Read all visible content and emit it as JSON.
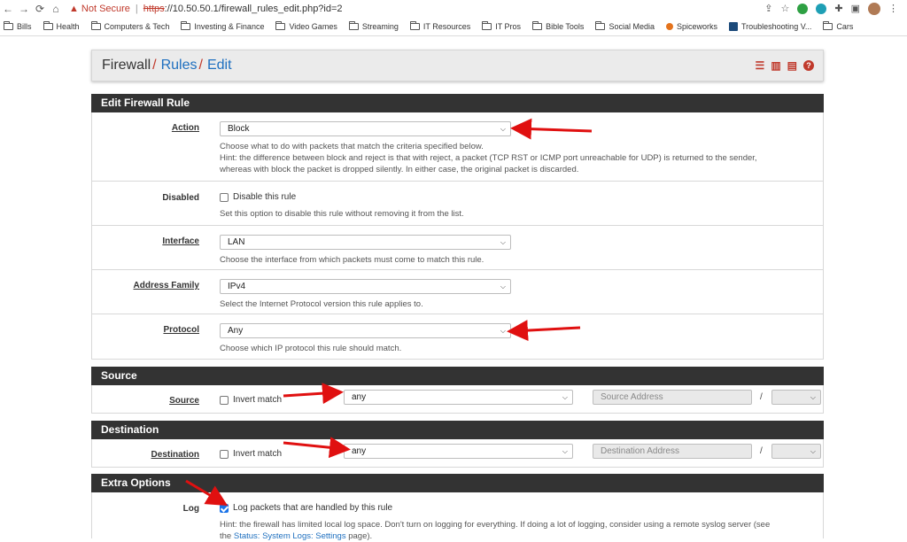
{
  "browser": {
    "security_label": "Not Secure",
    "url_protocol": "https",
    "url_rest": "://10.50.50.1/firewall_rules_edit.php?id=2",
    "bookmarks": [
      "Bills",
      "Health",
      "Computers & Tech",
      "Investing & Finance",
      "Video Games",
      "Streaming",
      "IT Resources",
      "IT Pros",
      "Bible Tools",
      "Social Media",
      "Spiceworks",
      "Troubleshooting V...",
      "Cars"
    ]
  },
  "breadcrumb": {
    "part1": "Firewall",
    "part2": "Rules",
    "part3": "Edit",
    "sep": "/"
  },
  "sections": {
    "edit_rule": "Edit Firewall Rule",
    "source": "Source",
    "destination": "Destination",
    "extra": "Extra Options"
  },
  "fields": {
    "action": {
      "label": "Action",
      "value": "Block",
      "help1": "Choose what to do with packets that match the criteria specified below.",
      "help2": "Hint: the difference between block and reject is that with reject, a packet (TCP RST or ICMP port unreachable for UDP) is returned to the sender,",
      "help3": "whereas with block the packet is dropped silently. In either case, the original packet is discarded."
    },
    "disabled": {
      "label": "Disabled",
      "checkbox": "Disable this rule",
      "help": "Set this option to disable this rule without removing it from the list."
    },
    "interface": {
      "label": "Interface",
      "value": "LAN",
      "help": "Choose the interface from which packets must come to match this rule."
    },
    "address_family": {
      "label": "Address Family",
      "value": "IPv4",
      "help": "Select the Internet Protocol version this rule applies to."
    },
    "protocol": {
      "label": "Protocol",
      "value": "Any",
      "help": "Choose which IP protocol this rule should match."
    },
    "source": {
      "label": "Source",
      "invert": "Invert match",
      "value": "any",
      "address_placeholder": "Source Address",
      "slash": "/"
    },
    "destination": {
      "label": "Destination",
      "invert": "Invert match",
      "value": "any",
      "address_placeholder": "Destination Address",
      "slash": "/"
    },
    "log": {
      "label": "Log",
      "checkbox": "Log packets that are handled by this rule",
      "help1": "Hint: the firewall has limited local log space. Don't turn on logging for everything. If doing a lot of logging, consider using a remote syslog server (see",
      "help2_prefix": "the",
      "help2_link": "Status: System Logs: Settings",
      "help2_suffix": "page)."
    }
  },
  "colors": {
    "accent_red": "#c0392b",
    "link_blue": "#1e6fbf",
    "panel_dark": "#333333",
    "arrow_red": "#e01010"
  }
}
